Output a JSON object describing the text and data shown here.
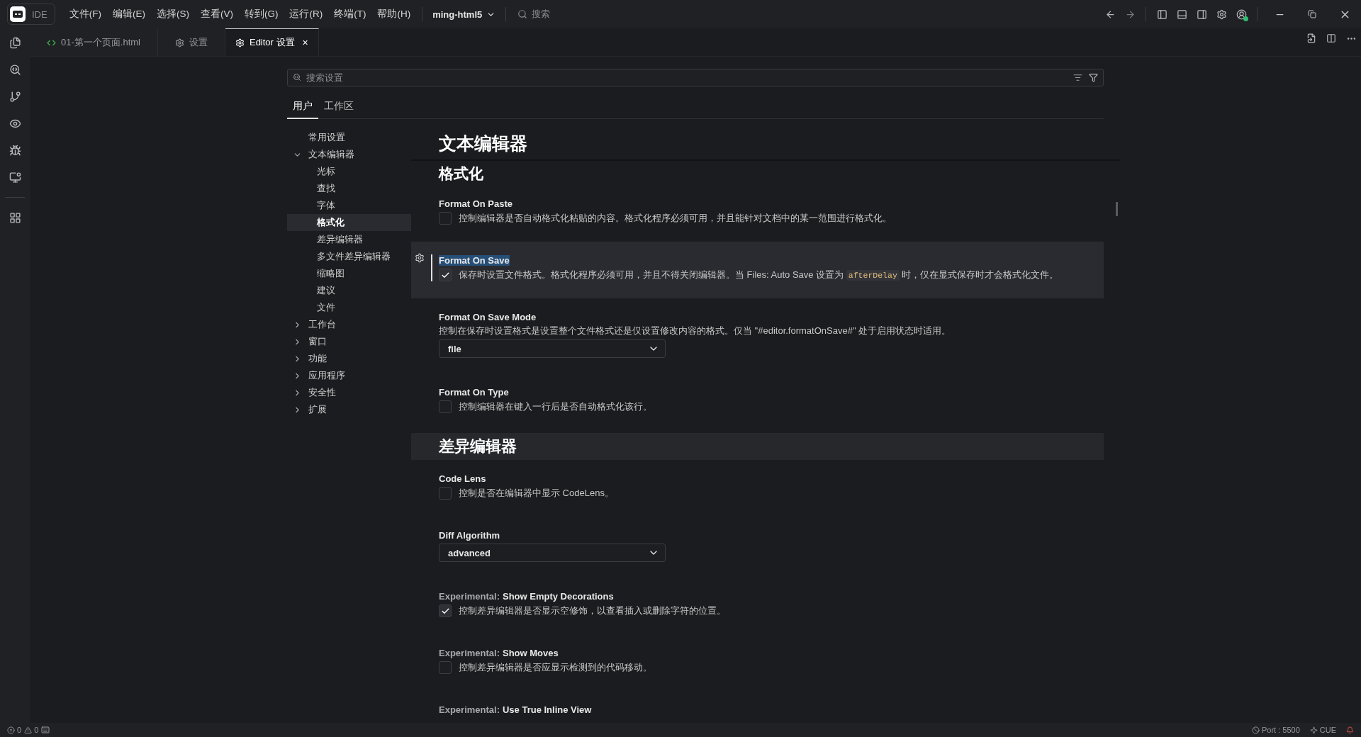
{
  "title_bar": {
    "app_label": "IDE",
    "menus": [
      "文件(F)",
      "编辑(E)",
      "选择(S)",
      "查看(V)",
      "转到(G)",
      "运行(R)",
      "终端(T)",
      "帮助(H)"
    ],
    "project": "ming-html5",
    "search": "搜索"
  },
  "editor_tabs": [
    {
      "label": "01-第一个页面.html",
      "selected": false
    },
    {
      "label": "设置",
      "selected": false
    },
    {
      "label": "Editor 设置",
      "selected": true,
      "close": "×"
    }
  ],
  "settings": {
    "search": {
      "placeholder": "搜索设置"
    },
    "scope_tabs": [
      {
        "label": "用户",
        "selected": true
      },
      {
        "label": "工作区",
        "selected": false
      }
    ],
    "toc": [
      {
        "label": "常用设置",
        "selected": false
      },
      {
        "label": "文本编辑器",
        "selected": false,
        "expanded": true,
        "children": [
          {
            "label": "光标",
            "selected": false
          },
          {
            "label": "查找",
            "selected": false
          },
          {
            "label": "字体",
            "selected": false
          },
          {
            "label": "格式化",
            "selected": true
          },
          {
            "label": "差异编辑器",
            "selected": false
          },
          {
            "label": "多文件差异编辑器",
            "selected": false
          },
          {
            "label": "缩略图",
            "selected": false
          },
          {
            "label": "建议",
            "selected": false
          },
          {
            "label": "文件",
            "selected": false
          }
        ]
      },
      {
        "label": "工作台",
        "selected": false,
        "expanded": false
      },
      {
        "label": "窗口",
        "selected": false,
        "expanded": false
      },
      {
        "label": "功能",
        "selected": false,
        "expanded": false
      },
      {
        "label": "应用程序",
        "selected": false,
        "expanded": false
      },
      {
        "label": "安全性",
        "selected": false,
        "expanded": false
      },
      {
        "label": "扩展",
        "selected": false,
        "expanded": false
      }
    ],
    "content": [
      {
        "kind": "title",
        "text": "文本编辑器"
      },
      {
        "kind": "subheading",
        "text": "格式化"
      },
      {
        "kind": "checkbox",
        "title": "Format On Paste",
        "checked": false,
        "focused": false,
        "description": [
          {
            "kind": "text",
            "text": "控制编辑器是否自动格式化粘贴的内容。格式化程序必须可用，并且能针对文档中的某一范围进行格式化。"
          }
        ]
      },
      {
        "kind": "checkbox",
        "title": "Format On Save",
        "checked": true,
        "focused": true,
        "description": [
          {
            "kind": "text",
            "text": "保存时设置文件格式。格式化程序必须可用，并且不得关闭编辑器。当 Files: Auto Save 设置为 "
          },
          {
            "kind": "code",
            "text": "afterDelay"
          },
          {
            "kind": "text",
            "text": " 时，仅在显式保存时才会格式化文件。"
          }
        ]
      },
      {
        "kind": "select",
        "title": "Format On Save Mode",
        "value": "file",
        "focused": false,
        "description": [
          {
            "kind": "text",
            "text": "控制在保存时设置格式是设置整个文件格式还是仅设置修改内容的格式。仅当 \"#editor.formatOnSave#\" 处于启用状态时适用。"
          }
        ]
      },
      {
        "kind": "checkbox",
        "title": "Format On Type",
        "checked": false,
        "focused": false,
        "description": [
          {
            "kind": "text",
            "text": "控制编辑器在键入一行后是否自动格式化该行。"
          }
        ]
      },
      {
        "kind": "section",
        "text": "差异编辑器"
      },
      {
        "kind": "checkbox",
        "title": "Code Lens",
        "checked": false,
        "focused": false,
        "description": [
          {
            "kind": "text",
            "text": "控制是否在编辑器中显示 CodeLens。"
          }
        ]
      },
      {
        "kind": "select",
        "title": "Diff Algorithm",
        "value": "advanced",
        "focused": false
      },
      {
        "kind": "checkbox",
        "category": "Experimental:",
        "title": "Show Empty Decorations",
        "checked": true,
        "focused": false,
        "description": [
          {
            "kind": "text",
            "text": "控制差异编辑器是否显示空修饰，以查看插入或删除字符的位置。"
          }
        ]
      },
      {
        "kind": "checkbox",
        "category": "Experimental:",
        "title": "Show Moves",
        "checked": false,
        "focused": false,
        "description": [
          {
            "kind": "text",
            "text": "控制差异编辑器是否应显示检测到的代码移动。"
          }
        ]
      },
      {
        "kind": "checkbox",
        "category": "Experimental:",
        "title": "Use True Inline View",
        "focused": false
      }
    ]
  },
  "status_bar": {
    "errors": "0",
    "warnings": "0",
    "port": "Port : 5500",
    "mode": "CUE"
  }
}
